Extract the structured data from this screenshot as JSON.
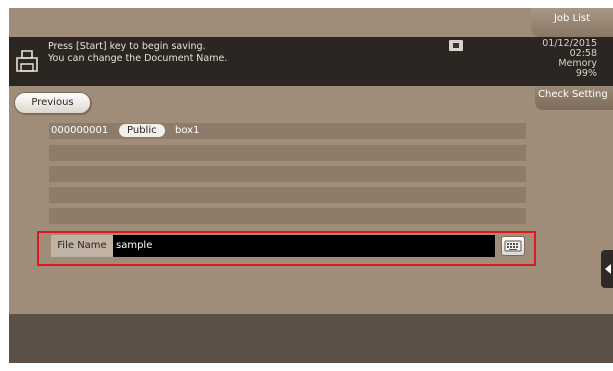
{
  "header": {
    "job_list_label": "Job List",
    "message_line1": "Press [Start] key to begin saving.",
    "message_line2": "You can change the Document Name.",
    "date": "01/12/2015",
    "time": "02:58",
    "memory_label": "Memory",
    "memory_value": "99%"
  },
  "nav": {
    "previous_label": "Previous",
    "check_setting_label": "Check Setting"
  },
  "box_list": {
    "rows": [
      {
        "number": "000000001",
        "type": "Public",
        "name": "box1"
      },
      {},
      {},
      {},
      {}
    ]
  },
  "file_name": {
    "label": "File Name",
    "value": "sample"
  },
  "icons": {
    "printer": "printer-icon",
    "memory": "memory-card-icon",
    "keyboard": "keyboard-icon",
    "side_panel": "chevron-left-icon"
  },
  "colors": {
    "background": "#a08d79",
    "message_bar": "#2b2622",
    "highlight": "#e1171e",
    "input_bg": "#000000"
  }
}
